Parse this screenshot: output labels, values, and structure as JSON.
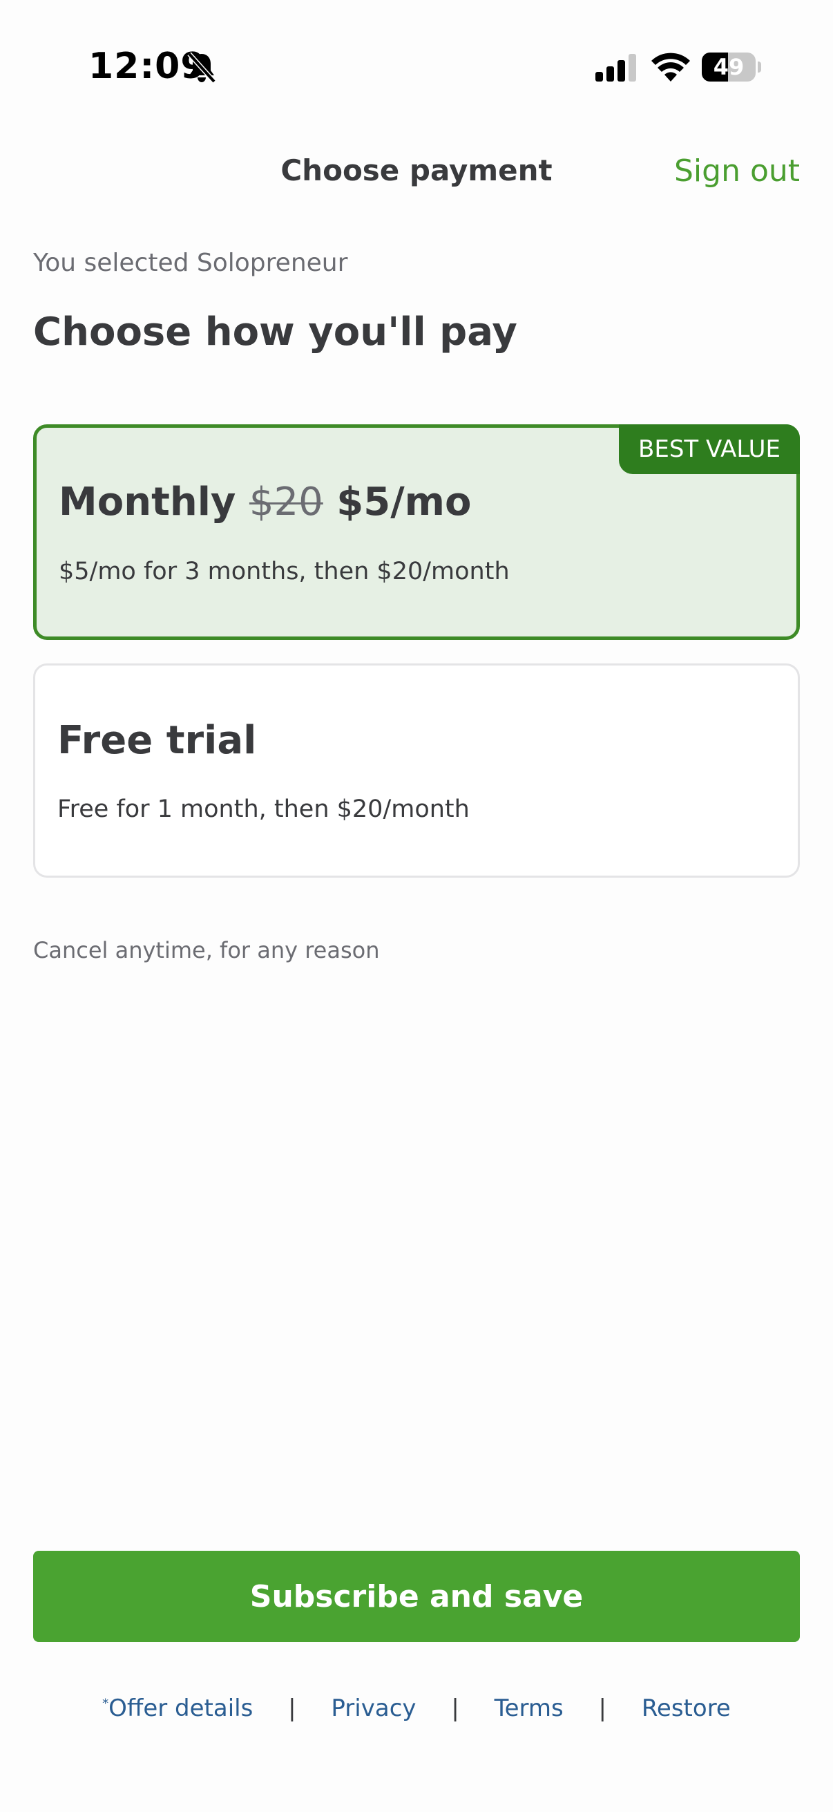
{
  "status_bar": {
    "time": "12:09",
    "battery": "49",
    "battery_level": 0.49
  },
  "header": {
    "title": "Choose payment",
    "sign_out_label": "Sign out"
  },
  "selection_note": "You selected Solopreneur",
  "heading": "Choose how you'll pay",
  "plans": [
    {
      "badge": "BEST VALUE",
      "name": "Monthly",
      "old_price": "$20",
      "new_price": "$5/mo",
      "description": "$5/mo for 3 months, then $20/month",
      "selected": true
    },
    {
      "name": "Free trial",
      "description": "Free for 1 month, then $20/month",
      "selected": false
    }
  ],
  "cancel_note": "Cancel anytime, for any reason",
  "cta_label": "Subscribe and save",
  "footer": {
    "offer_marker": "*",
    "offer_details": "Offer details",
    "privacy": "Privacy",
    "terms": "Terms",
    "restore": "Restore",
    "separator": "|"
  },
  "colors": {
    "brand_green": "#4aa331",
    "badge_green": "#2e7d1e",
    "selected_card_bg": "#e6f0e4",
    "link_blue": "#2a5d92"
  }
}
